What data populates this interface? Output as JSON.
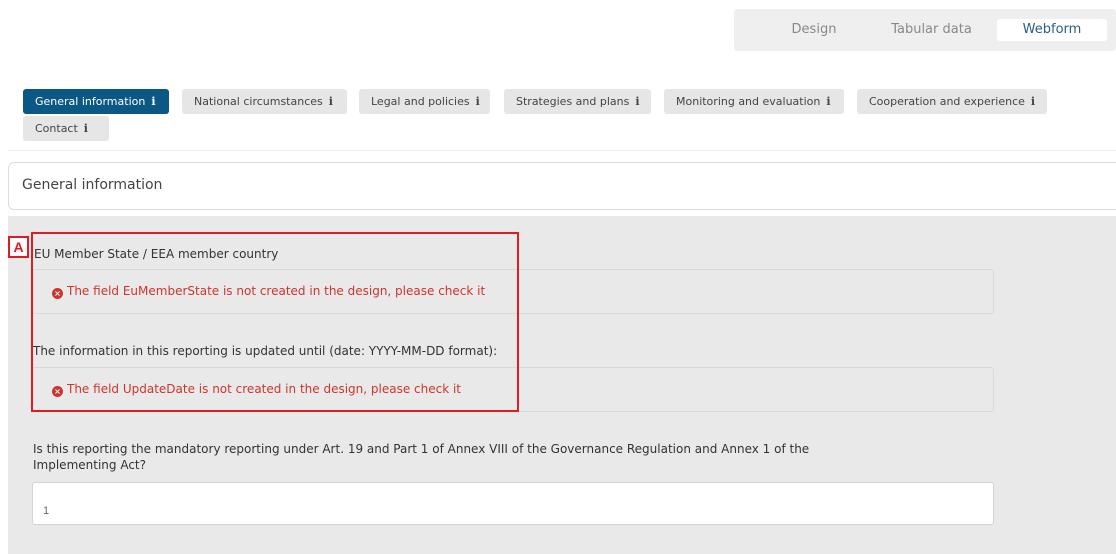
{
  "view_switch": {
    "design": "Design",
    "tabular": "Tabular data",
    "webform": "Webform",
    "selected": "Webform"
  },
  "tabs": [
    {
      "label": "General information",
      "active": true
    },
    {
      "label": "National circumstances",
      "active": false
    },
    {
      "label": "Legal and policies",
      "active": false
    },
    {
      "label": "Strategies and plans",
      "active": false
    },
    {
      "label": "Monitoring and evaluation",
      "active": false
    },
    {
      "label": "Cooperation and experience",
      "active": false
    },
    {
      "label": "Contact",
      "active": false
    }
  ],
  "info_glyph": "i",
  "section": {
    "title": "General information"
  },
  "fields": {
    "member_state": {
      "label": "EU Member State / EEA member country",
      "error": "The field EuMemberState is not created in the design, please check it"
    },
    "update_date": {
      "label": "The information in this reporting is updated until (date: YYYY-MM-DD format):",
      "error": "The field UpdateDate is not created in the design, please check it"
    },
    "mandatory_reporting": {
      "label": "Is this reporting the mandatory reporting under Art. 19 and Part 1 of Annex VIII of the Governance Regulation and Annex 1 of the Implementing Act?",
      "value": "1"
    }
  },
  "annotation": {
    "letter": "A"
  },
  "colors": {
    "active_tab": "#0b5885",
    "error_text": "#d0342c",
    "annotation": "#e01b24"
  }
}
